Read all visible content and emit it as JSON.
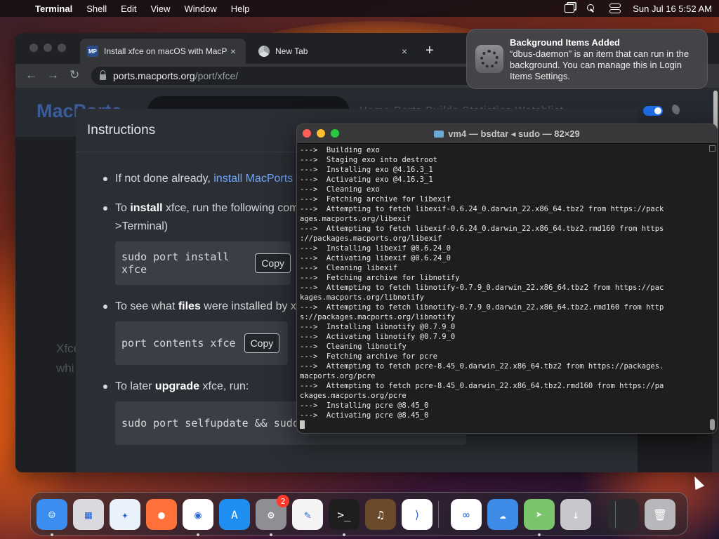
{
  "menubar": {
    "app": "Terminal",
    "items": [
      "Shell",
      "Edit",
      "View",
      "Window",
      "Help"
    ],
    "clock": "Sun Jul 16  5:52 AM"
  },
  "browser": {
    "tabs": [
      {
        "favicon": "MP",
        "title": "Install xfce on macOS with MacPorts",
        "close": "×"
      },
      {
        "title": "New Tab",
        "close": "×"
      }
    ],
    "new_tab": "+",
    "url_host": "ports.macports.org",
    "url_path": "/port/xfce/",
    "page": {
      "logo": "MacPorts",
      "nav": "Home   Ports   Builds   Statistics   Watchlist",
      "side_text_1": "Xfce",
      "side_text_2": "whi",
      "modal": {
        "title": "Instructions",
        "b1_pre": "If not done already, ",
        "b1_link": "install MacPorts",
        "b2_pre": "To ",
        "b2_bold": "install",
        "b2_post": " xfce, run the following command in macOS terminal (Applications->Utilities",
        "b2_line2": ">Terminal)",
        "code1": "sudo port install xfce",
        "copy": "Copy",
        "b3_pre": "To see what ",
        "b3_bold": "files",
        "b3_post": " were installed by xfce, run:",
        "code2": "port contents xfce",
        "b4_pre": "To later ",
        "b4_bold": "upgrade",
        "b4_post": " xfce, run:",
        "code3": "sudo port selfupdate && sudo port upgrade xfce"
      }
    }
  },
  "notification": {
    "title": "Background Items Added",
    "body": "“dbus-daemon” is an item that can run in the background. You can manage this in Login Items Settings."
  },
  "terminal": {
    "title": "vm4 — bsdtar ◂ sudo — 82×29",
    "lines": [
      "--->  Building exo",
      "--->  Staging exo into destroot",
      "--->  Installing exo @4.16.3_1",
      "--->  Activating exo @4.16.3_1",
      "--->  Cleaning exo",
      "--->  Fetching archive for libexif",
      "--->  Attempting to fetch libexif-0.6.24_0.darwin_22.x86_64.tbz2 from https://pack",
      "ages.macports.org/libexif",
      "--->  Attempting to fetch libexif-0.6.24_0.darwin_22.x86_64.tbz2.rmd160 from https",
      "://packages.macports.org/libexif",
      "--->  Installing libexif @0.6.24_0",
      "--->  Activating libexif @0.6.24_0",
      "--->  Cleaning libexif",
      "--->  Fetching archive for libnotify",
      "--->  Attempting to fetch libnotify-0.7.9_0.darwin_22.x86_64.tbz2 from https://pac",
      "kages.macports.org/libnotify",
      "--->  Attempting to fetch libnotify-0.7.9_0.darwin_22.x86_64.tbz2.rmd160 from http",
      "s://packages.macports.org/libnotify",
      "--->  Installing libnotify @0.7.9_0",
      "--->  Activating libnotify @0.7.9_0",
      "--->  Cleaning libnotify",
      "--->  Fetching archive for pcre",
      "--->  Attempting to fetch pcre-8.45_0.darwin_22.x86_64.tbz2 from https://packages.",
      "macports.org/pcre",
      "--->  Attempting to fetch pcre-8.45_0.darwin_22.x86_64.tbz2.rmd160 from https://pa",
      "ckages.macports.org/pcre",
      "--->  Installing pcre @8.45_0",
      "--->  Activating pcre @8.45_0"
    ]
  },
  "dock": {
    "apps": [
      {
        "name": "finder-icon",
        "bg": "#3b8df0"
      },
      {
        "name": "launchpad-icon",
        "bg": "#d9d9de"
      },
      {
        "name": "safari-icon",
        "bg": "#e9f2fb"
      },
      {
        "name": "firefox-icon",
        "bg": "#ff7139"
      },
      {
        "name": "chrome-icon",
        "bg": "#ffffff"
      },
      {
        "name": "app-store-icon",
        "bg": "#1f8ef1"
      },
      {
        "name": "system-settings-icon",
        "bg": "#8e8e93",
        "badge": "2"
      },
      {
        "name": "textedit-icon",
        "bg": "#f4f4f4"
      },
      {
        "name": "terminal-icon",
        "bg": "#1e1e1e"
      },
      {
        "name": "guitar-icon",
        "bg": "#6b4a2b"
      },
      {
        "name": "vscode-icon",
        "bg": "#ffffff"
      },
      {
        "name": "visual-studio-icon",
        "bg": "#ffffff"
      },
      {
        "name": "weather-icon",
        "bg": "#3d8be6"
      },
      {
        "name": "maps-icon",
        "bg": "#7ac46c"
      },
      {
        "name": "downloads-icon",
        "bg": "#c8c8cc"
      },
      {
        "name": "minimized-window-icon",
        "bg": "#2b2b2f"
      },
      {
        "name": "trash-icon",
        "bg": "#b8b8bc"
      }
    ]
  },
  "colors": {
    "accent": "#6ea8fe",
    "terminal_bg": "#1e1e1e",
    "traffic_red": "#ff5f57",
    "traffic_yellow": "#febc2e",
    "traffic_green": "#28c840"
  }
}
